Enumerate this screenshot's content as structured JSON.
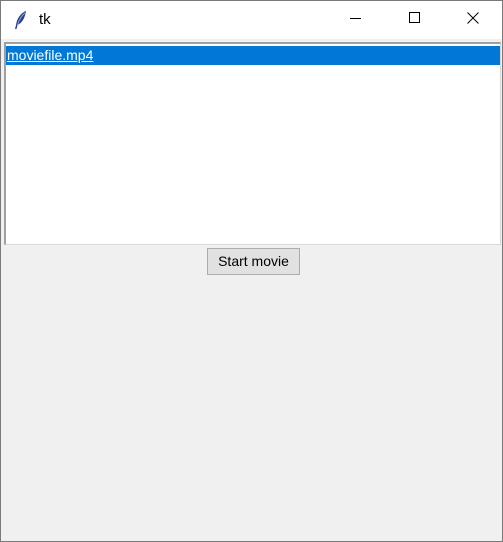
{
  "window": {
    "title": "tk",
    "icon": "feather-icon",
    "controls": {
      "minimize": "minimize-icon",
      "maximize": "maximize-icon",
      "close": "close-icon"
    }
  },
  "listbox": {
    "items": [
      {
        "label": "moviefile.mp4",
        "selected": true
      }
    ],
    "selection_color": "#0078d7"
  },
  "actions": {
    "start_label": "Start movie"
  }
}
